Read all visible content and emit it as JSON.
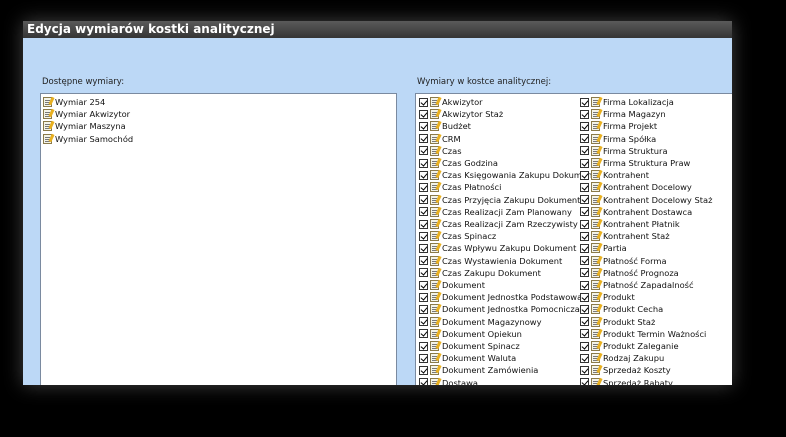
{
  "window": {
    "title": "Edycja wymiarów kostki analitycznej"
  },
  "available": {
    "label": "Dostępne wymiary:",
    "items": [
      "Wymiar 254",
      "Wymiar Akwizytor",
      "Wymiar Maszyna",
      "Wymiar Samochód"
    ]
  },
  "selected": {
    "label": "Wymiary w kostce analitycznej:",
    "col1": [
      "Akwizytor",
      "Akwizytor Staż",
      "Budżet",
      "CRM",
      "Czas",
      "Czas Godzina",
      "Czas Księgowania Zakupu Dokument",
      "Czas Płatności",
      "Czas Przyjęcia Zakupu Dokument",
      "Czas Realizacji Zam Planowany",
      "Czas Realizacji Zam Rzeczywisty",
      "Czas Spinacz",
      "Czas Wpływu Zakupu Dokument",
      "Czas Wystawienia Dokument",
      "Czas Zakupu Dokument",
      "Dokument",
      "Dokument Jednostka Podstawowa",
      "Dokument Jednostka Pomocnicza",
      "Dokument Magazynowy",
      "Dokument Opiekun",
      "Dokument Spinacz",
      "Dokument Waluta",
      "Dokument Zamówienia",
      "Dostawa"
    ],
    "col2": [
      "Firma Lokalizacja",
      "Firma Magazyn",
      "Firma Projekt",
      "Firma Spółka",
      "Firma Struktura",
      "Firma Struktura Praw",
      "Kontrahent",
      "Kontrahent Docelowy",
      "Kontrahent Docelowy Staż",
      "Kontrahent Dostawca",
      "Kontrahent Płatnik",
      "Kontrahent Staż",
      "Partia",
      "Płatność Forma",
      "Płatność Prognoza",
      "Płatność Zapadalność",
      "Produkt",
      "Produkt Cecha",
      "Produkt Staż",
      "Produkt Termin Ważności",
      "Produkt Zaleganie",
      "Rodzaj Zakupu",
      "Sprzedaż Koszty",
      "Sprzedaż Rabaty"
    ]
  }
}
